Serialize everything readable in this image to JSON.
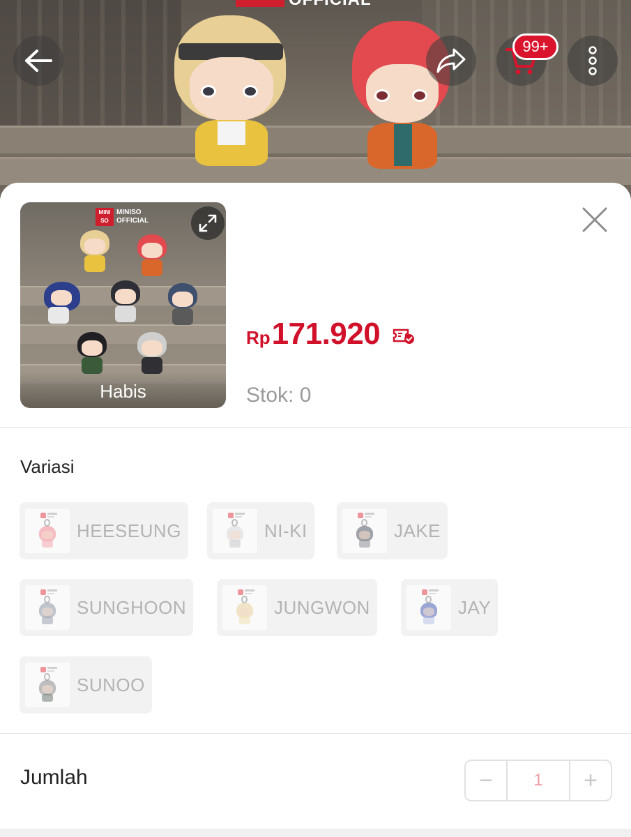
{
  "hero": {
    "brand_text": "OFFICIAL",
    "cart_badge": "99+",
    "icons": [
      "back-arrow-icon",
      "share-icon",
      "cart-icon",
      "more-vertical-icon"
    ]
  },
  "product": {
    "thumbnail_logo_box": "MINI SO",
    "thumbnail_logo_line1": "MINISO",
    "thumbnail_logo_line2": "OFFICIAL",
    "status_overlay": "Habis",
    "currency": "Rp",
    "price": "171.920",
    "stock": "Stok: 0"
  },
  "variation": {
    "title": "Variasi",
    "options": [
      {
        "label": "HEESEUNG",
        "hair": "#f08a94",
        "body": "#f2a7ae"
      },
      {
        "label": "NI-KI",
        "hair": "#d9d9d9",
        "body": "#c9c9c9"
      },
      {
        "label": "JAKE",
        "hair": "#555a66",
        "body": "#8a8e96"
      },
      {
        "label": "SUNGHOON",
        "hair": "#8e97a8",
        "body": "#9aa1ad"
      },
      {
        "label": "JUNGWON",
        "hair": "#e9d29a",
        "body": "#efe1b0"
      },
      {
        "label": "JAY",
        "hair": "#4a63b8",
        "body": "#b9c5e6"
      },
      {
        "label": "SUNOO",
        "hair": "#8a8a8a",
        "body": "#6f7c73"
      }
    ]
  },
  "quantity": {
    "label": "Jumlah",
    "value": "1",
    "minus": "−",
    "plus": "+"
  },
  "colors": {
    "price_red": "#d1112a",
    "badge_red": "#d9142c",
    "muted_text": "#b3b3b3"
  }
}
